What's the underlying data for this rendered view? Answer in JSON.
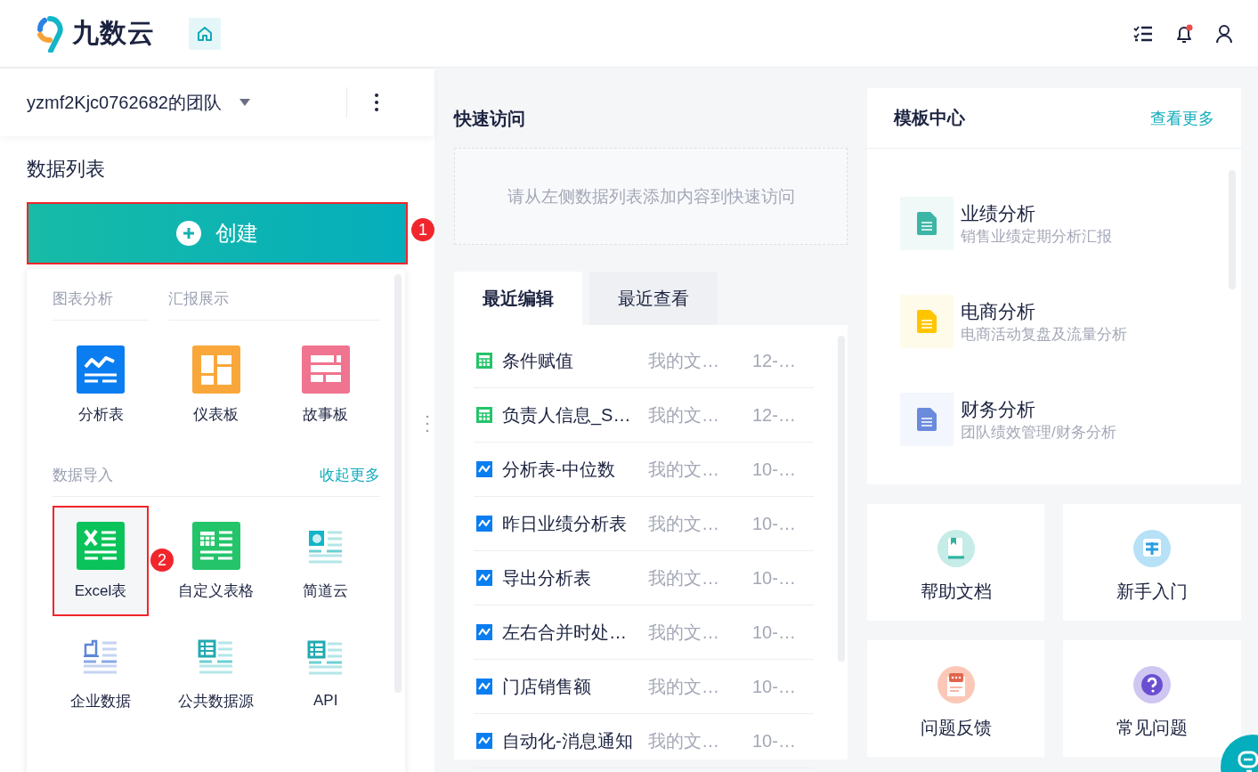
{
  "header": {
    "logo_text": "九数云",
    "notification_unread": true
  },
  "team": {
    "name": "yzmf2Kjc0762682的团队"
  },
  "data_list": {
    "title": "数据列表",
    "create_button": {
      "label": "创建",
      "highlighted": true,
      "badge": "1"
    }
  },
  "create_menu": {
    "sections": [
      {
        "headers": [
          "图表分析",
          "汇报展示"
        ],
        "items": [
          {
            "kind": "analysis",
            "label": "分析表",
            "highlighted": false
          },
          {
            "kind": "dashboard",
            "label": "仪表板",
            "highlighted": false
          },
          {
            "kind": "story",
            "label": "故事板",
            "highlighted": false
          }
        ]
      },
      {
        "headers": [
          "数据导入"
        ],
        "link": "收起更多",
        "items": [
          {
            "kind": "excel",
            "label": "Excel表",
            "highlighted": true,
            "badge": "2"
          },
          {
            "kind": "custom-table",
            "label": "自定义表格",
            "highlighted": false
          },
          {
            "kind": "jiandaoyun",
            "label": "简道云",
            "highlighted": false
          },
          {
            "kind": "enterprise",
            "label": "企业数据",
            "highlighted": false
          },
          {
            "kind": "public",
            "label": "公共数据源",
            "highlighted": false
          },
          {
            "kind": "api",
            "label": "API",
            "highlighted": false
          }
        ]
      }
    ]
  },
  "quick_access": {
    "title": "快速访问",
    "empty_text": "请从左侧数据列表添加内容到快速访问"
  },
  "recent": {
    "tabs": [
      {
        "label": "最近编辑",
        "selected": true
      },
      {
        "label": "最近查看",
        "selected": false
      }
    ],
    "rows": [
      {
        "kind": "table",
        "name": "条件赋值",
        "location": "我的文…",
        "date": "12-…"
      },
      {
        "kind": "table",
        "name": "负责人信息_S…",
        "location": "我的文…",
        "date": "12-…"
      },
      {
        "kind": "analysis",
        "name": "分析表-中位数",
        "location": "我的文…",
        "date": "10-…"
      },
      {
        "kind": "analysis",
        "name": "昨日业绩分析表",
        "location": "我的文…",
        "date": "10-…"
      },
      {
        "kind": "analysis",
        "name": "导出分析表",
        "location": "我的文…",
        "date": "10-…"
      },
      {
        "kind": "analysis",
        "name": "左右合并时处…",
        "location": "我的文…",
        "date": "10-…"
      },
      {
        "kind": "analysis",
        "name": "门店销售额",
        "location": "我的文…",
        "date": "10-…"
      },
      {
        "kind": "analysis",
        "name": "自动化-消息通知",
        "location": "我的文…",
        "date": "10-…"
      }
    ]
  },
  "template_center": {
    "title": "模板中心",
    "more_link": "查看更多",
    "items": [
      {
        "title": "业绩分析",
        "subtitle": "销售业绩定期分析汇报",
        "color": "#3cb5a5"
      },
      {
        "title": "电商分析",
        "subtitle": "电商活动复盘及流量分析",
        "color": "#ffc600"
      },
      {
        "title": "财务分析",
        "subtitle": "团队绩效管理/财务分析",
        "color": "#6a8bdc"
      }
    ]
  },
  "shortcuts": [
    {
      "kind": "help",
      "label": "帮助文档"
    },
    {
      "kind": "guide",
      "label": "新手入门"
    },
    {
      "kind": "feedback",
      "label": "问题反馈"
    },
    {
      "kind": "faq",
      "label": "常见问题"
    }
  ]
}
